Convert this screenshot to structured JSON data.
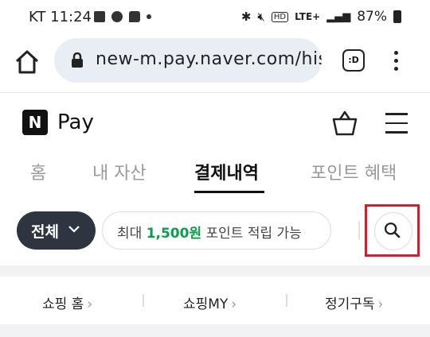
{
  "status_bar": {
    "time": "KT 11:24",
    "battery": "87%",
    "network": "LTE+"
  },
  "browser": {
    "url": "new-m.pay.naver.com/his",
    "tab_switcher": ":D"
  },
  "app": {
    "logo_letter": "N",
    "brand": "Pay"
  },
  "tabs": [
    {
      "label": "홈"
    },
    {
      "label": "내 자산"
    },
    {
      "label": "결제내역"
    },
    {
      "label": "포인트 혜택"
    }
  ],
  "filter": {
    "all_label": "전체"
  },
  "promo": {
    "prefix": "최대 ",
    "highlight": "1,500원",
    "suffix": " 포인트 적립 가능",
    "highlight_color": "#0a9e4b"
  },
  "quick_links": [
    {
      "label": "쇼핑 홈"
    },
    {
      "label": "쇼핑MY"
    },
    {
      "label": "정기구독"
    }
  ],
  "colors": {
    "highlight_box": "#d81c2b",
    "all_button_bg": "#2f3540"
  }
}
